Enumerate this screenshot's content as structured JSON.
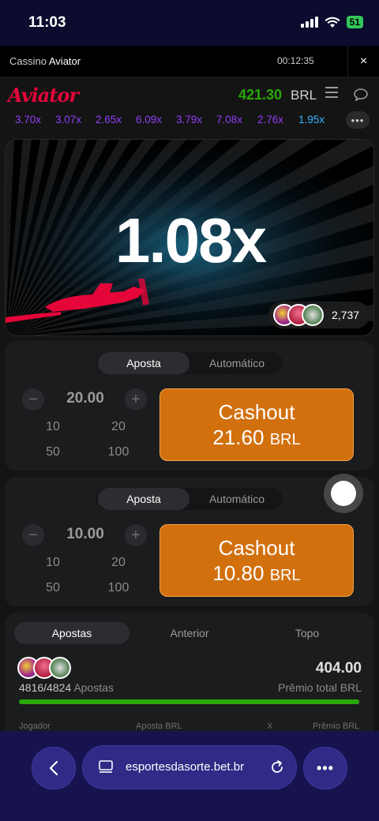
{
  "status_bar": {
    "time": "11:03",
    "battery": "51"
  },
  "browser_header": {
    "prefix": "Cassino",
    "game": "Aviator",
    "timer": "00:12:35",
    "close": "×"
  },
  "game": {
    "logo": "Aviator",
    "balance": "421.30",
    "currency": "BRL",
    "history": [
      {
        "value": "3.70x",
        "color": "#913ef8"
      },
      {
        "value": "3.07x",
        "color": "#913ef8"
      },
      {
        "value": "2.65x",
        "color": "#913ef8"
      },
      {
        "value": "6.09x",
        "color": "#913ef8"
      },
      {
        "value": "3.79x",
        "color": "#913ef8"
      },
      {
        "value": "7.08x",
        "color": "#913ef8"
      },
      {
        "value": "2.76x",
        "color": "#913ef8"
      },
      {
        "value": "1.95x",
        "color": "#34b4ff"
      }
    ],
    "multiplier": "1.08x",
    "players_count": "2,737",
    "accent_color": "#e50539"
  },
  "bet_panels": [
    {
      "tabs": [
        "Aposta",
        "Automático"
      ],
      "amount": "20.00",
      "quick": [
        "10",
        "20",
        "50",
        "100"
      ],
      "cashout_label": "Cashout",
      "cashout_amount": "21.60",
      "cashout_currency": "BRL"
    },
    {
      "tabs": [
        "Aposta",
        "Automático"
      ],
      "amount": "10.00",
      "quick": [
        "10",
        "20",
        "50",
        "100"
      ],
      "cashout_label": "Cashout",
      "cashout_amount": "10.80",
      "cashout_currency": "BRL"
    }
  ],
  "bets_list": {
    "tabs": [
      "Apostas",
      "Anterior",
      "Topo"
    ],
    "count": "4816/4824",
    "count_label": "Apostas",
    "total_prize": "404.00",
    "total_prize_label": "Prêmio total BRL",
    "progress": 0.998,
    "columns": [
      "Jogador",
      "Aposta BRL",
      "X",
      "Prêmio BRL"
    ]
  },
  "nav_bar": {
    "url": "esportesdasorte.bet.br"
  }
}
